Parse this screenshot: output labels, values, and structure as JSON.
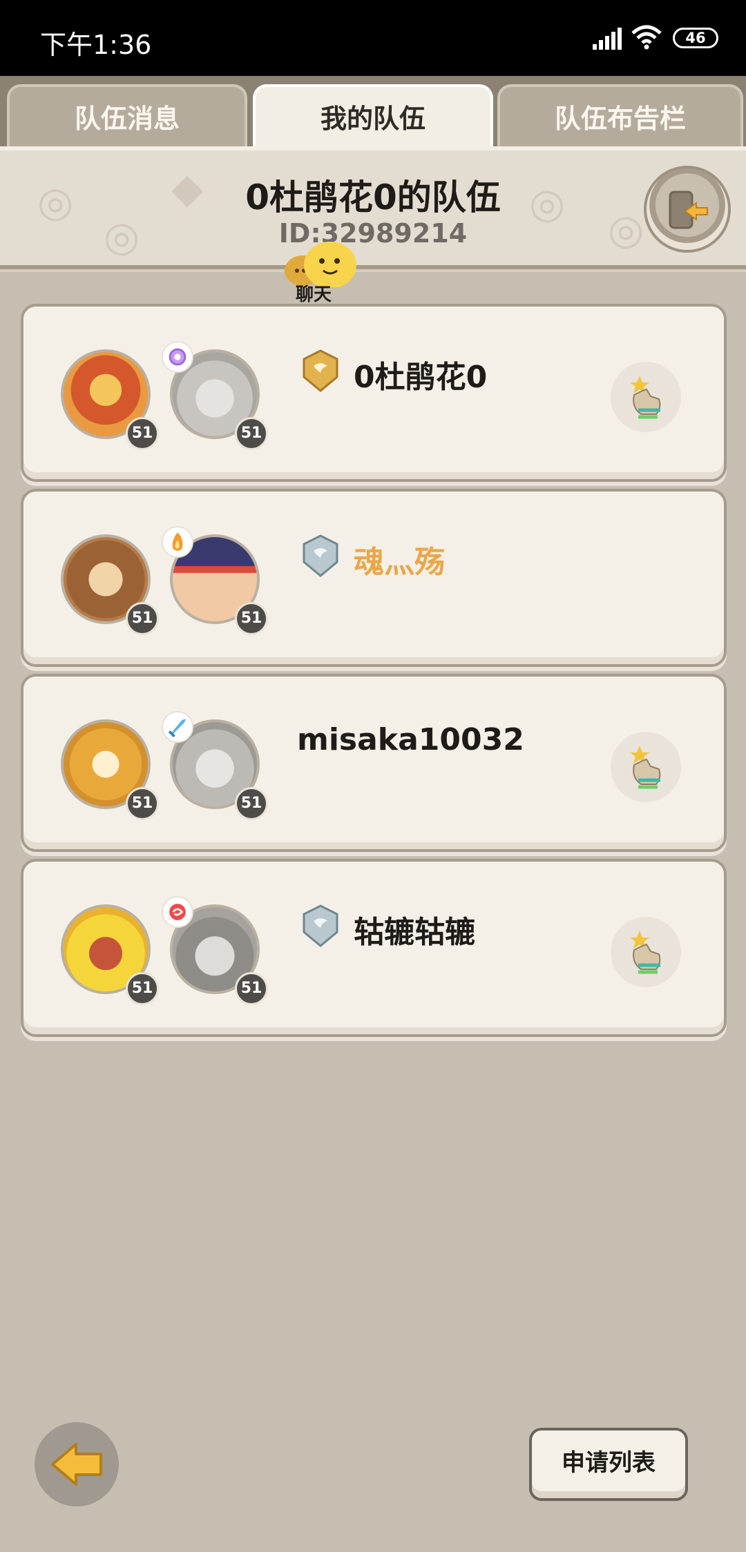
{
  "status_bar": {
    "time": "下午1:36",
    "battery": "46"
  },
  "tabs": [
    {
      "label": "队伍消息",
      "active": false
    },
    {
      "label": "我的队伍",
      "active": true
    },
    {
      "label": "队伍布告栏",
      "active": false
    }
  ],
  "team": {
    "title": "0杜鹃花0的队伍",
    "id": "ID:32989214"
  },
  "chat": {
    "label": "聊天"
  },
  "members": [
    {
      "name": "0杜鹃花0",
      "pet_level": "51",
      "hero_level": "51",
      "rank_icon": "gold-shield-icon",
      "class_icon": "purple-swirl-icon",
      "name_color": "#1e1b18"
    },
    {
      "name": "魂灬殇",
      "pet_level": "51",
      "hero_level": "51",
      "rank_icon": "silver-shield-icon",
      "class_icon": "orange-flame-icon",
      "name_color": "#e9a74a"
    },
    {
      "name": "misaka10032",
      "pet_level": "51",
      "hero_level": "51",
      "rank_icon": "",
      "class_icon": "blue-sword-icon",
      "name_color": "#1e1b18"
    },
    {
      "name": "轱辘轱辘",
      "pet_level": "51",
      "hero_level": "51",
      "rank_icon": "silver-shield-icon",
      "class_icon": "red-swirl-icon",
      "name_color": "#1e1b18"
    }
  ],
  "footer": {
    "apply_list_label": "申请列表"
  },
  "colors": {
    "background": "#c6beb1",
    "card": "#f5f0e7",
    "accent_orange": "#e9a74a",
    "gold": "#d7a84a"
  }
}
